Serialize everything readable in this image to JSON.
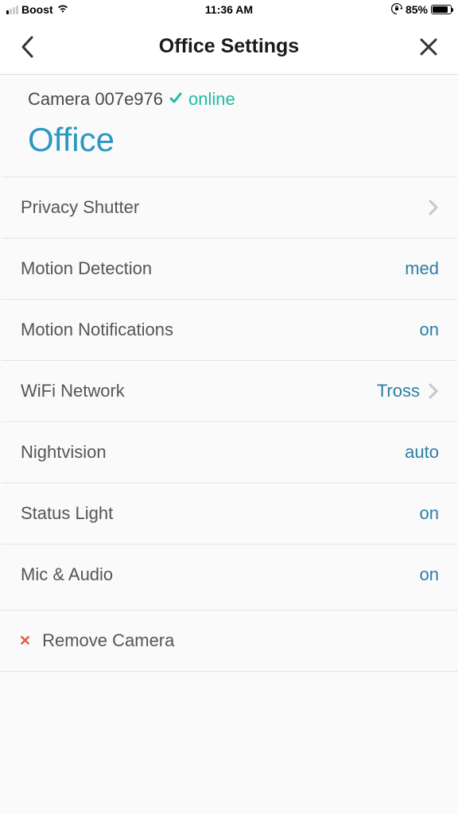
{
  "statusbar": {
    "carrier": "Boost",
    "time": "11:36 AM",
    "battery_pct": "85%",
    "battery_fill": "85%"
  },
  "header": {
    "title": "Office Settings"
  },
  "camera": {
    "id_label": "Camera 007e976",
    "status_text": "online",
    "name": "Office"
  },
  "settings": {
    "privacy_shutter": {
      "label": "Privacy Shutter",
      "value": ""
    },
    "motion_detection": {
      "label": "Motion Detection",
      "value": "med"
    },
    "motion_notifications": {
      "label": "Motion Notifications",
      "value": "on"
    },
    "wifi_network": {
      "label": "WiFi Network",
      "value": "Tross"
    },
    "nightvision": {
      "label": "Nightvision",
      "value": "auto"
    },
    "status_light": {
      "label": "Status Light",
      "value": "on"
    },
    "mic_audio": {
      "label": "Mic & Audio",
      "value": "on"
    }
  },
  "remove": {
    "label": "Remove Camera"
  }
}
